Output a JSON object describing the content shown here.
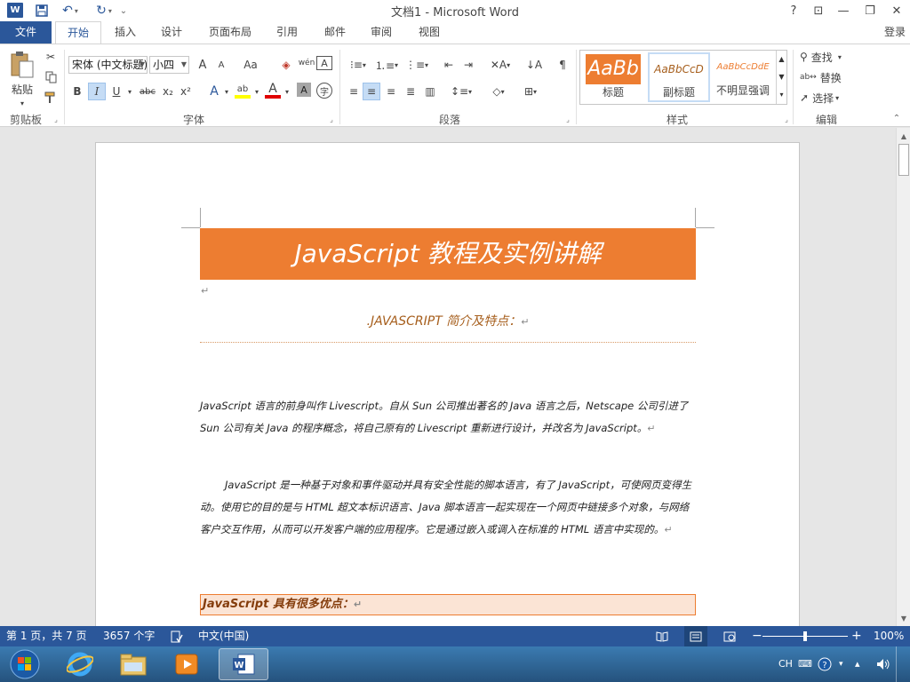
{
  "titlebar": {
    "app_icon": "W",
    "title": "文档1 - Microsoft Word",
    "help": "?",
    "ribbon_display": "⊡",
    "minimize": "—",
    "restore": "❐",
    "close": "✕"
  },
  "tabs": {
    "file": "文件",
    "items": [
      "开始",
      "插入",
      "设计",
      "页面布局",
      "引用",
      "邮件",
      "审阅",
      "视图"
    ],
    "login": "登录"
  },
  "ribbon": {
    "clipboard": {
      "paste": "粘贴",
      "label": "剪贴板"
    },
    "font": {
      "font_name": "宋体 (中文标题)",
      "font_size": "小四",
      "grow": "A",
      "shrink": "A",
      "change_case": "Aa",
      "phonetic": "wén",
      "border_char": "A",
      "bold": "B",
      "italic": "I",
      "underline": "U",
      "strike": "abc",
      "subscript": "x₂",
      "superscript": "x²",
      "effects": "A",
      "highlight": "ab",
      "font_color": "A",
      "shading": "A",
      "enclose": "字",
      "label": "字体"
    },
    "paragraph": {
      "label": "段落"
    },
    "styles": {
      "items": [
        {
          "sample": "AaBb",
          "name": "标题"
        },
        {
          "sample": "AaBbCcD",
          "name": "副标题"
        },
        {
          "sample": "AaBbCcDdE",
          "name": "不明显强调"
        }
      ],
      "label": "样式"
    },
    "editing": {
      "find": "查找",
      "replace": "替换",
      "select": "选择",
      "label": "编辑"
    }
  },
  "document": {
    "banner_title": "JavaScript 教程及实例讲解",
    "subheading": ".JAVASCRIPT 简介及特点：",
    "paragraph1": "JavaScript 语言的前身叫作 Livescript。自从 Sun 公司推出著名的 Java 语言之后，Netscape 公司引进了 Sun 公司有关 Java 的程序概念，将自己原有的 Livescript 重新进行设计，并改名为 JavaScript。",
    "paragraph2": "JavaScript 是一种基于对象和事件驱动并具有安全性能的脚本语言，有了 JavaScript，可使网页变得生动。使用它的目的是与 HTML 超文本标识语言、Java 脚本语言一起实现在一个网页中链接多个对象，与网络客户交互作用，从而可以开发客户端的应用程序。它是通过嵌入或调入在标准的 HTML 语言中实现的。",
    "shaded_heading": "JavaScript 具有很多优点：",
    "para_mark": "↵"
  },
  "statusbar": {
    "page": "第 1 页，共 7 页",
    "words": "3657 个字",
    "language": "中文(中国)",
    "zoom": "100%"
  },
  "taskbar": {
    "ime": "CH"
  },
  "colors": {
    "word_blue": "#2b579a",
    "banner_orange": "#ed7d31",
    "shaded_fill": "#fbe4d5"
  }
}
